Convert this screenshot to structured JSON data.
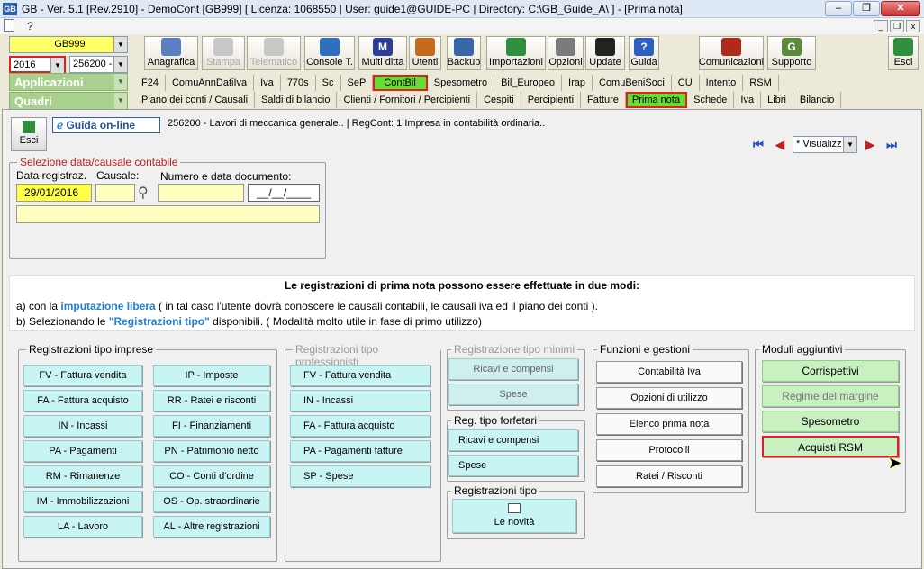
{
  "titlebar": {
    "text": "GB - Ver. 5.1 [Rev.2910] - DemoCont [GB999]    [ Licenza: 1068550 | User: guide1@GUIDE-PC | Directory: C:\\GB_Guide_A\\ ] - [Prima nota]",
    "app_icon": "GB"
  },
  "menubar": {
    "help": "?"
  },
  "selectors": {
    "company": "GB999",
    "year": "2016",
    "ditta": "256200 -"
  },
  "toolbar": [
    {
      "label": "Anagrafica",
      "icon": "folders-icon",
      "color": "#5a7fc0"
    },
    {
      "label": "Stampa",
      "icon": "printer-icon",
      "color": "#c8c8c8"
    },
    {
      "label": "Telematico",
      "icon": "quill-icon",
      "color": "#c8c8c8"
    },
    {
      "label": "Console T.",
      "icon": "monitor-icon",
      "color": "#2f6fbf"
    },
    {
      "label": "Multi ditta",
      "icon": "m-icon",
      "glyph": "M",
      "color": "#2b3e9a"
    },
    {
      "label": "Utenti",
      "icon": "users-icon",
      "color": "#c56a1a"
    },
    {
      "label": "Backup",
      "icon": "backup-icon",
      "color": "#3a66a8"
    },
    {
      "label": "Importazioni",
      "icon": "download-icon",
      "color": "#2f8f3f"
    },
    {
      "label": "Opzioni",
      "icon": "wrench-icon",
      "color": "#7a7a7a"
    },
    {
      "label": "Update",
      "icon": "update-icon",
      "color": "#222"
    },
    {
      "label": "Guida",
      "icon": "help-icon",
      "glyph": "?",
      "color": "#2c5fbf"
    },
    {
      "label": "Comunicazioni",
      "icon": "message-icon",
      "color": "#b02a1a"
    },
    {
      "label": "Supporto",
      "icon": "support-icon",
      "glyph": "G",
      "color": "#5a8a3a"
    },
    {
      "label": "Esci",
      "icon": "exit-icon",
      "color": "#2f8f3f"
    }
  ],
  "sidebar": {
    "applicazioni": "Applicazioni",
    "quadri": "Quadri"
  },
  "app_tabs": [
    "F24",
    "ComuAnnDatiIva",
    "Iva",
    "770s",
    "Sc",
    "SeP",
    "ContBil",
    "Spesometro",
    "Bil_Europeo",
    "Irap",
    "ComuBeniSoci",
    "CU",
    "Intento",
    "RSM"
  ],
  "quadri_tabs": [
    "Piano dei conti / Causali",
    "Saldi di bilancio",
    "Clienti / Fornitori / Percipienti",
    "Cespiti",
    "Percipienti",
    "Fatture",
    "Prima nota",
    "Schede",
    "Iva",
    "Libri",
    "Bilancio"
  ],
  "form": {
    "esci": "Esci",
    "guida_online": "Guida on-line",
    "company_info": "256200 - Lavori di meccanica generale..  | RegCont: 1 Impresa  in contabilità ordinaria..",
    "visualizza": "* Visualizz",
    "selezione_title": "Selezione data/causale contabile",
    "data_label": "Data registraz.",
    "data_value": "29/01/2016",
    "causale_label": "Causale:",
    "numero_label": "Numero e data documento:",
    "date_mask": "__/__/____"
  },
  "info": {
    "heading": "Le registrazioni di prima nota possono essere effettuate in due modi:",
    "line_a_pre": "a) con la ",
    "line_a_link": "imputazione libera",
    "line_a_post": " ( in tal caso l'utente dovrà conoscere le causali contabili, le causali iva ed il piano dei conti ).",
    "line_b_pre": "b) Selezionando le ",
    "line_b_link": "\"Registrazioni tipo\"",
    "line_b_post": " disponibili. ( Modalità molto utile in fase di primo utilizzo)"
  },
  "imprese": {
    "title": "Registrazioni tipo imprese",
    "left": [
      "FV - Fattura vendita",
      "FA - Fattura acquisto",
      "IN - Incassi",
      "PA - Pagamenti",
      "RM - Rimanenze",
      "IM - Immobilizzazioni",
      "LA - Lavoro"
    ],
    "right": [
      "IP - Imposte",
      "RR - Ratei e risconti",
      "FI - Finanziamenti",
      "PN - Patrimonio netto",
      "CO - Conti d'ordine",
      "OS - Op. straordinarie",
      "AL - Altre registrazioni"
    ]
  },
  "professionisti": {
    "title": "Registrazioni tipo professionisti",
    "items": [
      "FV - Fattura vendita",
      "IN - Incassi",
      "FA - Fattura acquisto",
      "PA - Pagamenti fatture",
      "SP - Spese"
    ]
  },
  "minimi": {
    "title": "Registrazione tipo minimi",
    "items": [
      "Ricavi e compensi",
      "Spese"
    ]
  },
  "forfetari": {
    "title": "Reg. tipo forfetari",
    "items": [
      "Ricavi e compensi",
      "Spese"
    ]
  },
  "registrazioni_tipo": {
    "title": "Registrazioni tipo",
    "novita": "Le novità"
  },
  "funzioni": {
    "title": "Funzioni e gestioni",
    "items": [
      "Contabilità Iva",
      "Opzioni di utilizzo",
      "Elenco prima nota",
      "Protocolli",
      "Ratei / Risconti"
    ]
  },
  "moduli": {
    "title": "Moduli aggiuntivi",
    "items": [
      "Corrispettivi",
      "Regime del margine",
      "Spesometro",
      "Acquisti RSM"
    ]
  }
}
